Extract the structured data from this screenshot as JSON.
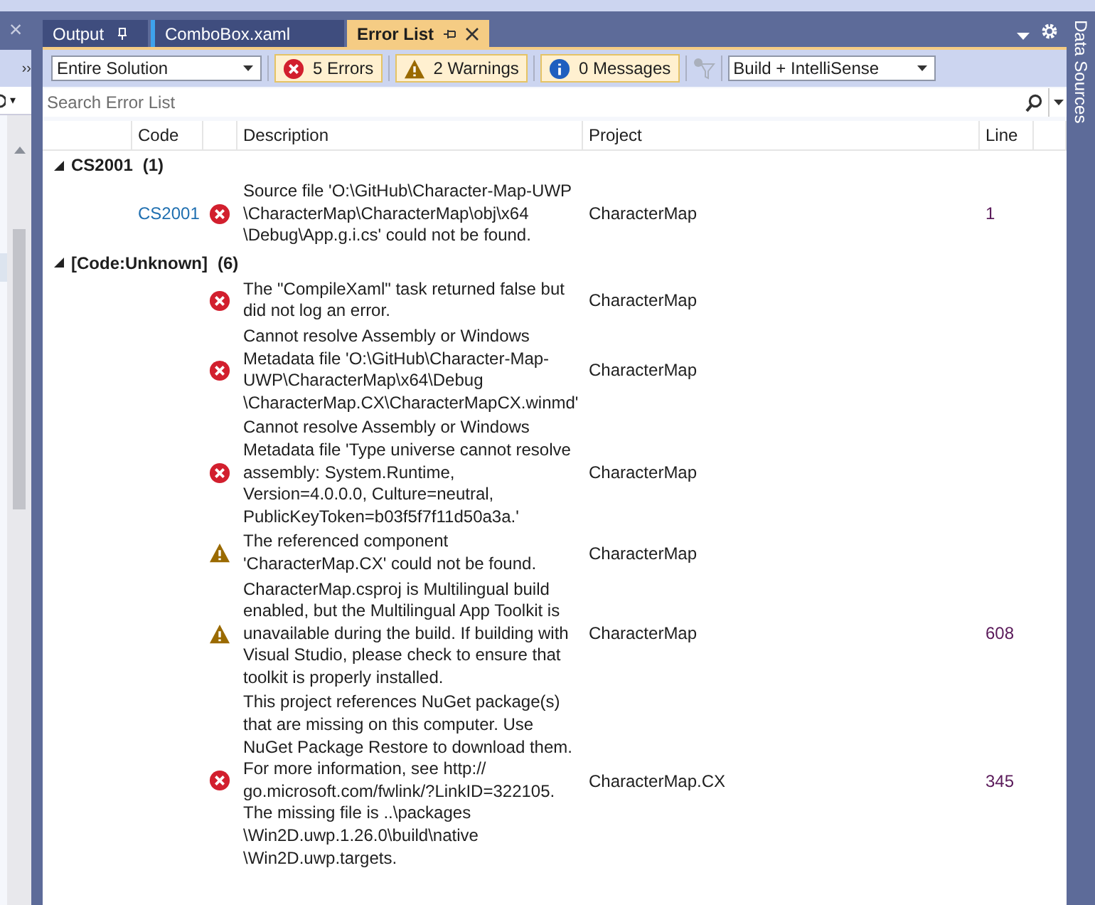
{
  "left_panel": {
    "close": "×",
    "overflow": "››",
    "dropdown": "▾"
  },
  "tabs": [
    {
      "label": "Output",
      "selected": false,
      "pinned": false,
      "preview": false
    },
    {
      "label": "ComboBox.xaml",
      "selected": false,
      "preview": true
    },
    {
      "label": "Error List",
      "selected": true,
      "pinned": true,
      "preview": false
    }
  ],
  "toolbar": {
    "scope": "Entire Solution",
    "filters": [
      {
        "kind": "error",
        "label": "5 Errors",
        "selected": true
      },
      {
        "kind": "warning",
        "label": "2 Warnings",
        "selected": true
      },
      {
        "kind": "info",
        "label": "0 Messages",
        "selected": true
      }
    ],
    "source": "Build + IntelliSense"
  },
  "search": {
    "placeholder": "Search Error List"
  },
  "columns": [
    "Code",
    "Description",
    "Project",
    "Line"
  ],
  "groups": [
    {
      "label": "CS2001",
      "count": "(1)",
      "expanded": true,
      "rows": [
        {
          "code": "CS2001",
          "kind": "error",
          "description": "Source file 'O:\\GitHub\\Character-Map-UWP \\CharacterMap\\CharacterMap\\obj\\x64 \\Debug\\App.g.i.cs' could not be found.",
          "project": "CharacterMap",
          "line": "1"
        }
      ]
    },
    {
      "label": "[Code:Unknown]",
      "count": "(6)",
      "expanded": true,
      "rows": [
        {
          "kind": "error",
          "description": "The \"CompileXaml\" task returned false but did not log an error.",
          "project": "CharacterMap"
        },
        {
          "kind": "error",
          "description": "Cannot resolve Assembly or Windows Metadata file 'O:\\GitHub\\Character-Map-UWP\\CharacterMap\\x64\\Debug \\CharacterMap.CX\\CharacterMapCX.winmd'",
          "project": "CharacterMap"
        },
        {
          "kind": "error",
          "description": "Cannot resolve Assembly or Windows Metadata file 'Type universe cannot resolve assembly: System.Runtime, Version=4.0.0.0, Culture=neutral, PublicKeyToken=b03f5f7f11d50a3a.'",
          "project": "CharacterMap"
        },
        {
          "kind": "warning",
          "description": "The referenced component 'CharacterMap.CX' could not be found.",
          "project": "CharacterMap"
        },
        {
          "kind": "warning",
          "description": "CharacterMap.csproj is Multilingual build enabled, but the Multilingual App Toolkit is unavailable during the build. If building with Visual Studio, please check to ensure that toolkit is properly installed.",
          "project": "CharacterMap",
          "line": "608"
        },
        {
          "kind": "error",
          "description": "This project references NuGet package(s) that are missing on this computer. Use NuGet Package Restore to download them. For more information, see http:// go.microsoft.com/fwlink/?LinkID=322105. The missing file is ..\\packages \\Win2D.uwp.1.26.0\\build\\native \\Win2D.uwp.targets.",
          "project": "CharacterMap.CX",
          "line": "345"
        }
      ]
    }
  ],
  "side_panel": {
    "title": "Data Sources"
  }
}
